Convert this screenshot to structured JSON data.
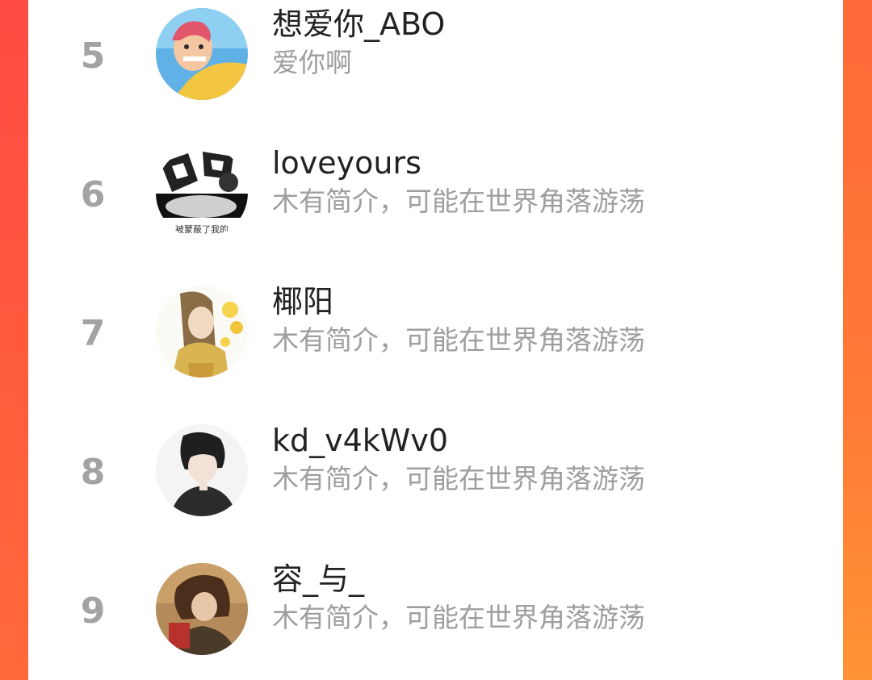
{
  "rows": [
    {
      "rank": "5",
      "name": "想爱你_ABO",
      "bio": "爱你啊"
    },
    {
      "rank": "6",
      "name": "loveyours",
      "bio": "木有简介，可能在世界角落游荡"
    },
    {
      "rank": "7",
      "name": "椰阳",
      "bio": "木有简介，可能在世界角落游荡"
    },
    {
      "rank": "8",
      "name": "kd_v4kWv0",
      "bio": "木有简介，可能在世界角落游荡"
    },
    {
      "rank": "9",
      "name": "容_与_",
      "bio": "木有简介，可能在世界角落游荡"
    }
  ],
  "avatar_5_caption": "",
  "avatar_6_caption": "被蒙蔽了我的",
  "colors": {
    "accent_left": "#ff4a3d",
    "accent_right": "#ff8a3a",
    "rank": "#a3a3a3",
    "name": "#222222",
    "bio": "#9e9e9e"
  }
}
